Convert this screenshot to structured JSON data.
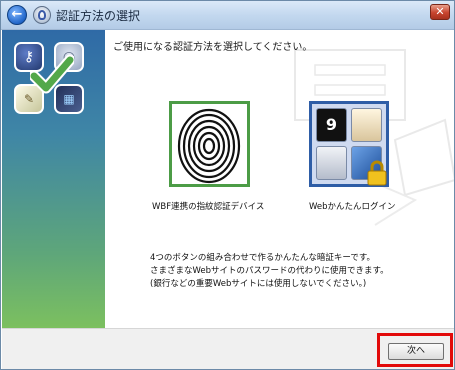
{
  "window": {
    "title": "認証方法の選択",
    "back_glyph": "←",
    "close_glyph": "✕"
  },
  "sidebar": {
    "icons": [
      "key-icon",
      "fingerprint-icon",
      "brush-icon",
      "keyboard-icon",
      "checkmark-icon"
    ],
    "accent": "#53a84a"
  },
  "main": {
    "instruction": "ご使用になる認証方法を選択してください。",
    "options": [
      {
        "label": "WBF連携の指紋認証デバイス",
        "icon": "fingerprint-icon",
        "border_color": "#4c9c46"
      },
      {
        "label": "Webかんたんログイン",
        "icon": "web-login-icon",
        "tile_number": "9",
        "border_color": "#2e5da6"
      }
    ],
    "description": [
      "4つのボタンの組み合わせで作るかんたんな暗証キーです。",
      "さまざまなWebサイトのパスワードの代わりに使用できます。",
      "(銀行などの重要Webサイトには使用しないでください。)"
    ]
  },
  "footer": {
    "next_label": "次へ",
    "highlight_color": "#e20a0a"
  }
}
